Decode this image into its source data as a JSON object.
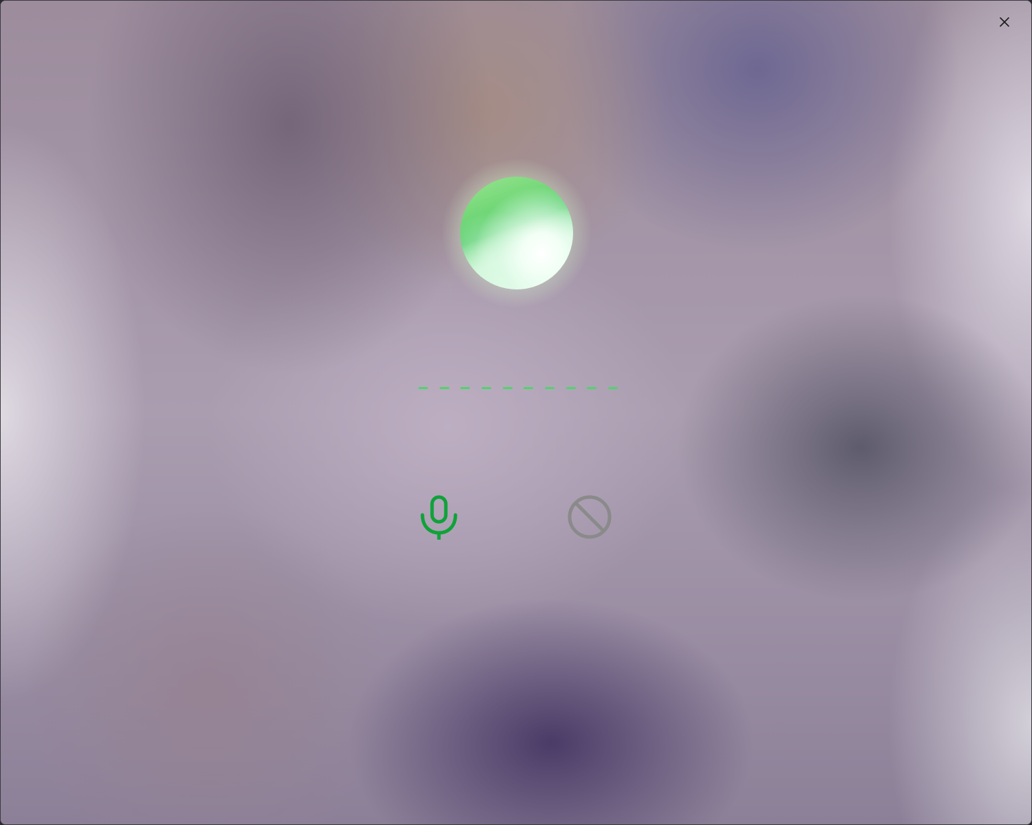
{
  "window": {
    "title": "",
    "background_tones": [
      "#9c8c9c",
      "#aa9db0",
      "#5a4a70",
      "#c8c2cc"
    ]
  },
  "titlebar": {
    "close_icon": "close-icon"
  },
  "assistant": {
    "orb_icon": "voice-orb-icon",
    "orb_colors": {
      "green": "#4fca66",
      "light": "#c6f3d4",
      "white": "#ffffff"
    },
    "wave_icon": "audio-wave-icon",
    "wave_color": "#4fd46b",
    "wave_segments": 10
  },
  "controls": {
    "mic": {
      "icon": "microphone-icon",
      "color": "#0fa23a"
    },
    "block": {
      "icon": "block-icon",
      "color": "#8a8a8a"
    }
  }
}
